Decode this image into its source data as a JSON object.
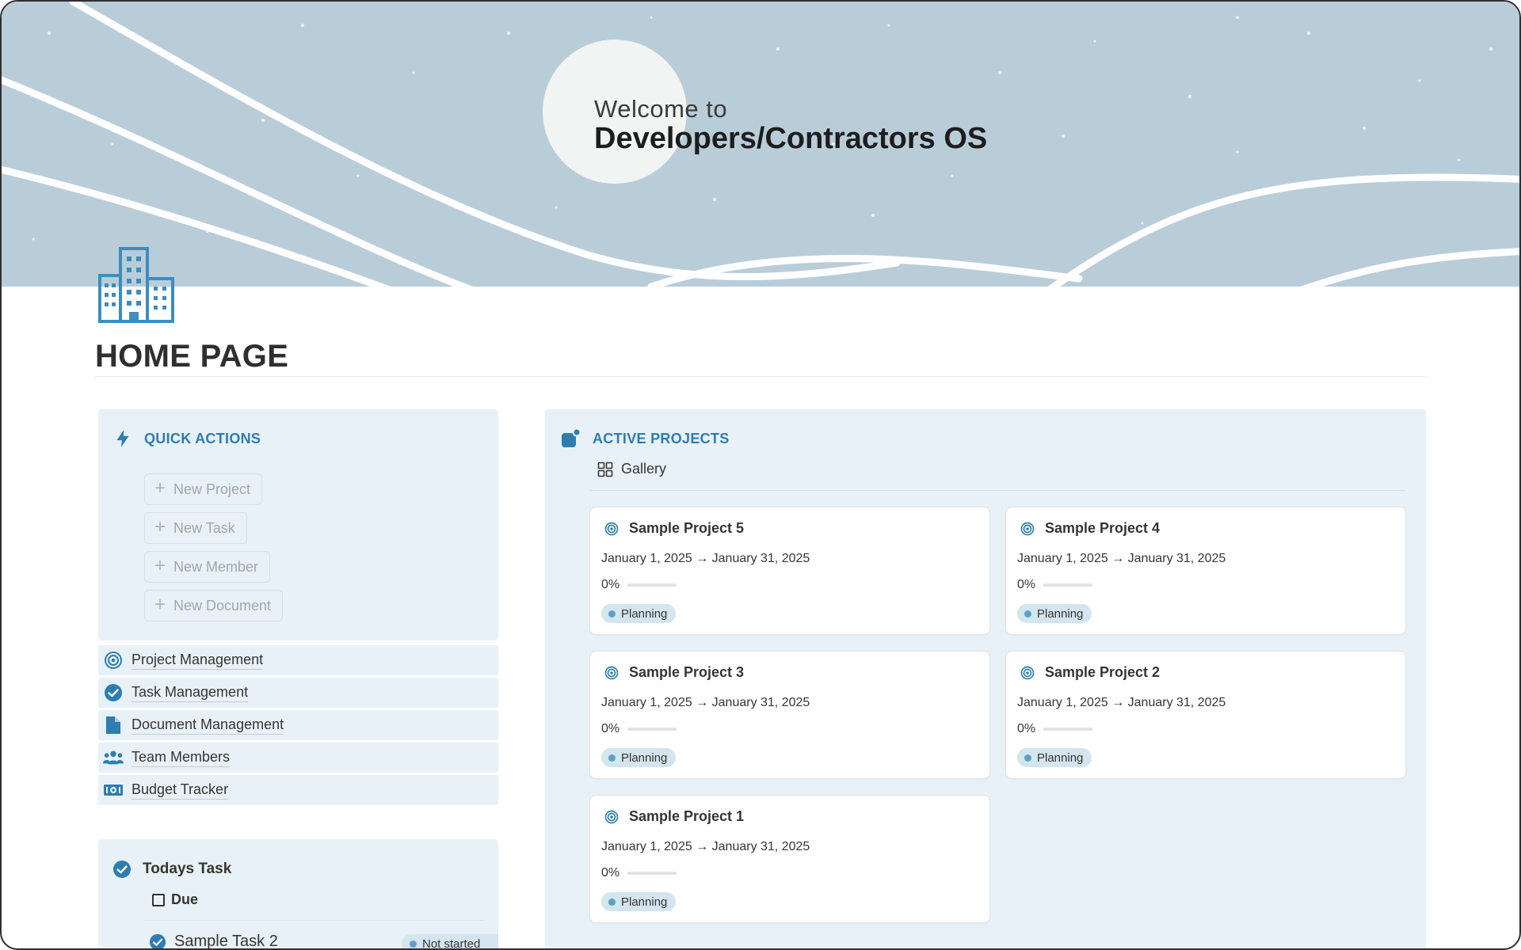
{
  "banner": {
    "welcome": "Welcome to",
    "title": "Developers/Contractors OS"
  },
  "page": {
    "icon": "office-building-icon",
    "title": "HOME PAGE"
  },
  "quick_actions": {
    "heading": "QUICK ACTIONS",
    "icon": "lightning-bolt-icon",
    "buttons": [
      {
        "label": "New Project"
      },
      {
        "label": "New Task"
      },
      {
        "label": "New Member"
      },
      {
        "label": "New Document"
      }
    ]
  },
  "nav": [
    {
      "label": "Project Management",
      "icon": "target-icon"
    },
    {
      "label": "Task Management",
      "icon": "check-circle-icon"
    },
    {
      "label": "Document Management",
      "icon": "document-icon"
    },
    {
      "label": "Team Members",
      "icon": "people-icon"
    },
    {
      "label": "Budget Tracker",
      "icon": "banknote-icon"
    }
  ],
  "todays_task": {
    "heading": "Todays Task",
    "tab": "Due",
    "rows": [
      {
        "name": "Sample Task 2",
        "status": "Not started"
      }
    ]
  },
  "active_projects": {
    "heading": "ACTIVE PROJECTS",
    "view": "Gallery",
    "projects": [
      {
        "name": "Sample Project 5",
        "dates": "January 1, 2025 → January 31, 2025",
        "progress_label": "0%",
        "progress": 0,
        "status": "Planning"
      },
      {
        "name": "Sample Project 4",
        "dates": "January 1, 2025 → January 31, 2025",
        "progress_label": "0%",
        "progress": 0,
        "status": "Planning"
      },
      {
        "name": "Sample Project 3",
        "dates": "January 1, 2025 → January 31, 2025",
        "progress_label": "0%",
        "progress": 0,
        "status": "Planning"
      },
      {
        "name": "Sample Project 2",
        "dates": "January 1, 2025 → January 31, 2025",
        "progress_label": "0%",
        "progress": 0,
        "status": "Planning"
      },
      {
        "name": "Sample Project 1",
        "dates": "January 1, 2025 → January 31, 2025",
        "progress_label": "0%",
        "progress": 0,
        "status": "Planning"
      }
    ]
  },
  "colors": {
    "accent": "#2e7db0",
    "panel": "#e8f1f8",
    "banner": "#b9cdd9",
    "status_dot": "#5e9fc8"
  }
}
